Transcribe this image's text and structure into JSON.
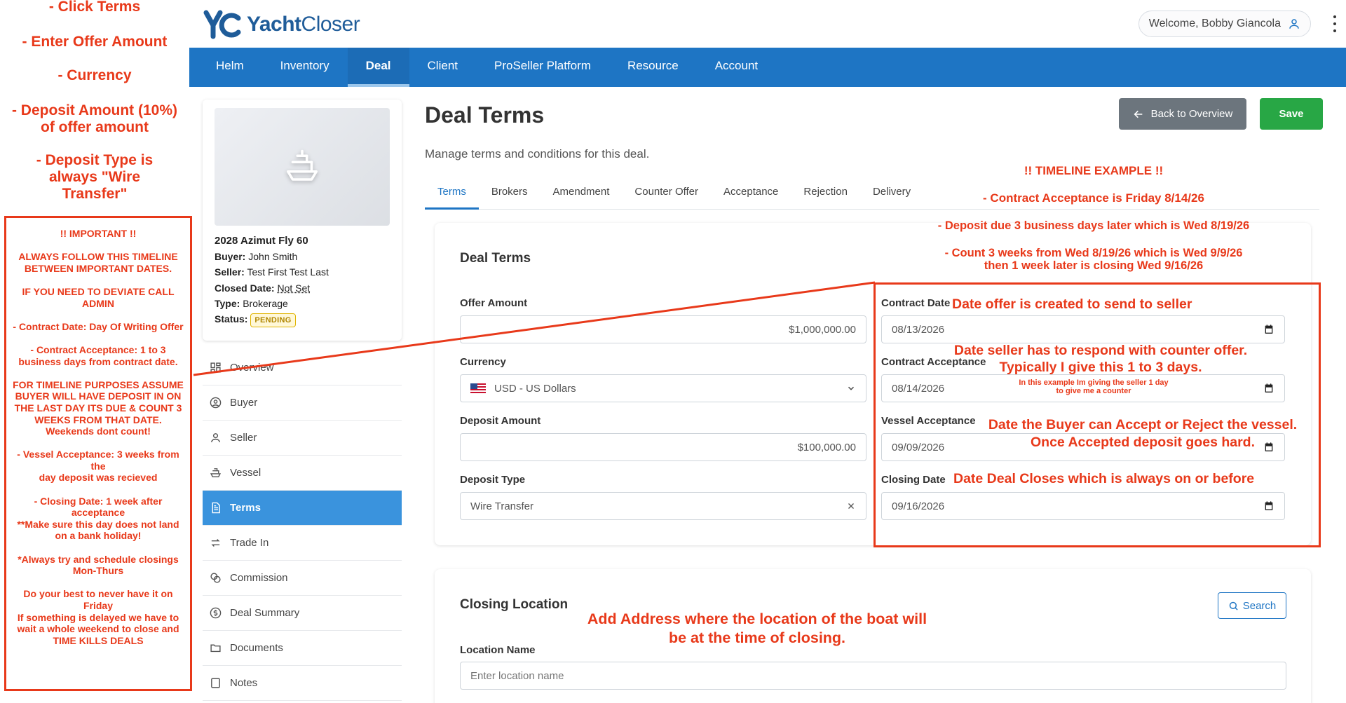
{
  "left_tips": [
    "- Click Terms",
    "- Enter Offer Amount",
    "- Currency",
    "- Deposit Amount (10%) of offer amount",
    "- Deposit Type is always \"Wire Transfer\""
  ],
  "important_note": "!! IMPORTANT !!\n\nALWAYS FOLLOW THIS TIMELINE BETWEEN IMPORTANT DATES.\n\nIF YOU NEED TO DEVIATE CALL ADMIN\n\n- Contract Date: Day Of Writing Offer\n\n- Contract Acceptance: 1 to 3 business days from contract date.\n\nFOR TIMELINE PURPOSES ASSUME BUYER WILL HAVE DEPOSIT IN ON THE LAST DAY ITS DUE & COUNT 3 WEEKS FROM THAT DATE.\nWeekends dont count!\n\n- Vessel Acceptance: 3 weeks from the\nday deposit was recieved\n\n- Closing Date: 1 week after acceptance\n**Make sure this day does not land on a bank holiday!\n\n*Always try and schedule closings Mon-Thurs\n\nDo your best to never have it on Friday\nIf something is delayed we have to wait a whole weekend to close and TIME KILLS DEALS",
  "header": {
    "logo_mark": "yc",
    "brand_bold": "Yacht",
    "brand_light": "Closer",
    "welcome": "Welcome, Bobby Giancola"
  },
  "nav": [
    "Helm",
    "Inventory",
    "Deal",
    "Client",
    "ProSeller Platform",
    "Resource",
    "Account"
  ],
  "deal_card": {
    "title": "2028 Azimut Fly 60",
    "buyer_label": "Buyer:",
    "buyer": "John Smith",
    "seller_label": "Seller:",
    "seller": "Test First Test Last",
    "closed_label": "Closed Date:",
    "closed": "Not Set",
    "type_label": "Type:",
    "type": "Brokerage",
    "status_label": "Status:",
    "status": "PENDING"
  },
  "side_menu": [
    {
      "label": "Overview",
      "icon": "grid-icon"
    },
    {
      "label": "Buyer",
      "icon": "user-circle-icon"
    },
    {
      "label": "Seller",
      "icon": "user-icon"
    },
    {
      "label": "Vessel",
      "icon": "ship-icon"
    },
    {
      "label": "Terms",
      "icon": "document-icon"
    },
    {
      "label": "Trade In",
      "icon": "swap-icon"
    },
    {
      "label": "Commission",
      "icon": "coins-icon"
    },
    {
      "label": "Deal Summary",
      "icon": "dollar-circle-icon"
    },
    {
      "label": "Documents",
      "icon": "folder-icon"
    },
    {
      "label": "Notes",
      "icon": "note-icon"
    }
  ],
  "page": {
    "title": "Deal Terms",
    "subtitle": "Manage terms and conditions for this deal.",
    "back": "Back to Overview",
    "save": "Save"
  },
  "tabs": [
    "Terms",
    "Brokers",
    "Amendment",
    "Counter Offer",
    "Acceptance",
    "Rejection",
    "Delivery"
  ],
  "terms": {
    "card_title": "Deal Terms",
    "offer_label": "Offer Amount",
    "offer": "$1,000,000.00",
    "currency_label": "Currency",
    "currency": "USD - US Dollars",
    "deposit_label": "Deposit Amount",
    "deposit": "$100,000.00",
    "deposit_type_label": "Deposit Type",
    "deposit_type": "Wire Transfer",
    "contract_date_label": "Contract Date",
    "contract_date": "08/13/2026",
    "contract_acc_label": "Contract Acceptance",
    "contract_acc": "08/14/2026",
    "vessel_acc_label": "Vessel Acceptance",
    "vessel_acc": "09/09/2026",
    "closing_label": "Closing Date",
    "closing": "09/16/2026"
  },
  "location": {
    "card_title": "Closing Location",
    "search": "Search",
    "name_label": "Location Name",
    "name_placeholder": "Enter location name"
  },
  "annotations": {
    "timeline_title": "!! TIMELINE EXAMPLE !!",
    "timeline_1": "- Contract Acceptance is Friday 8/14/26",
    "timeline_2": "- Deposit due 3 business days later which is Wed 8/19/26",
    "timeline_3": "- Count 3 weeks from Wed 8/19/26 which is Wed 9/9/26\nthen 1 week later is closing Wed 9/16/26",
    "contract_date_note": "Date offer is created to send to seller",
    "contract_acc_note": "Date seller has to respond with counter offer.\nTypically I give this 1 to 3 days.",
    "contract_acc_small": "In this example Im giving the seller 1 day\nto give me a counter",
    "vessel_note": "Date the Buyer can Accept or Reject the vessel.\nOnce Accepted deposit goes hard.",
    "closing_note": "Date Deal Closes which is always on or before",
    "location_note": "Add Address where the location of the boat will\nbe at the time of closing."
  },
  "colors": {
    "nav": "#1e75c4",
    "accent_red": "#e8391a",
    "save": "#28a745",
    "back": "#6c757d",
    "active_menu": "#3a93dd"
  }
}
